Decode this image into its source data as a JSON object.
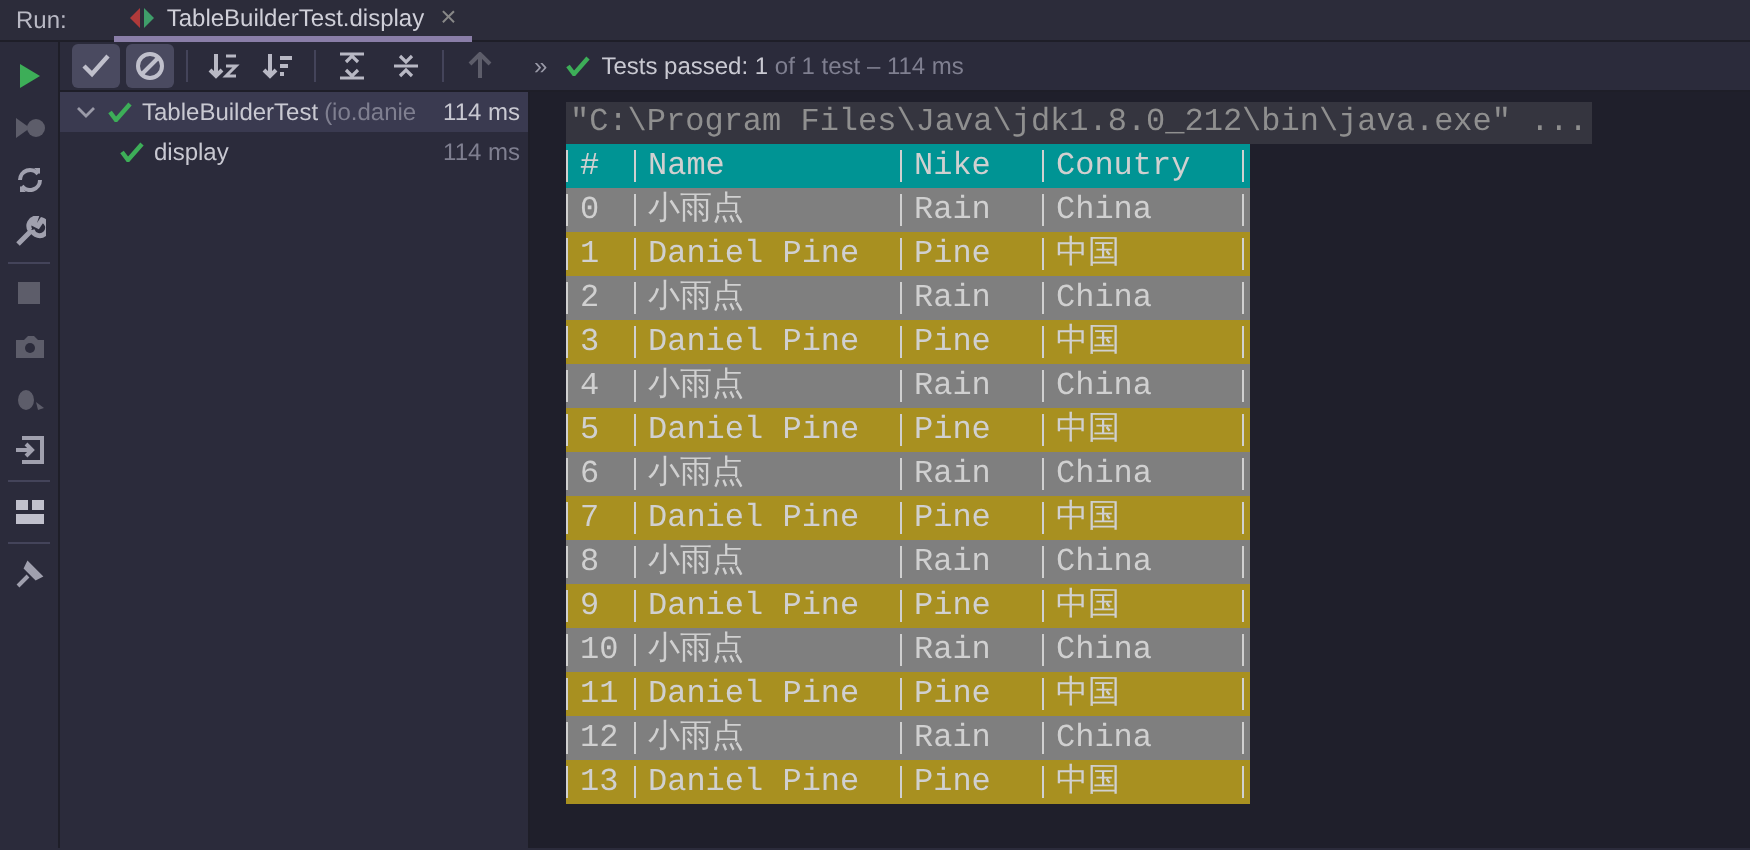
{
  "run_bar": {
    "label": "Run:",
    "tab": {
      "title": "TableBuilderTest.display",
      "close": "×",
      "selected": true
    }
  },
  "toolbar": {
    "toggles": [
      {
        "kind": "check",
        "selected": true
      },
      {
        "kind": "ignored",
        "selected": true
      }
    ],
    "overflow": "»",
    "status": {
      "passed": "Tests passed: 1",
      "rest": "of 1 test – 114 ms"
    }
  },
  "tree": [
    {
      "name": "TableBuilderTest",
      "package": "(io.danie",
      "time": "114 ms",
      "expanded": true,
      "selected": true,
      "children": [
        {
          "name": "display",
          "time": "114 ms",
          "selected": false
        }
      ]
    }
  ],
  "console": {
    "command": "\"C:\\Program Files\\Java\\jdk1.8.0_212\\bin\\java.exe\" ...",
    "rows": [
      {
        "color": "#009494",
        "cells": [
          "#",
          "Name",
          "Nike",
          "Conutry"
        ]
      },
      {
        "color": "#7f7f7f",
        "cells": [
          "0",
          "小雨点",
          "Rain",
          "China"
        ]
      },
      {
        "color": "#a89020",
        "cells": [
          "1",
          "Daniel Pine",
          "Pine",
          "中国"
        ]
      },
      {
        "color": "#7f7f7f",
        "cells": [
          "2",
          "小雨点",
          "Rain",
          "China"
        ]
      },
      {
        "color": "#a89020",
        "cells": [
          "3",
          "Daniel Pine",
          "Pine",
          "中国"
        ]
      },
      {
        "color": "#7f7f7f",
        "cells": [
          "4",
          "小雨点",
          "Rain",
          "China"
        ]
      },
      {
        "color": "#a89020",
        "cells": [
          "5",
          "Daniel Pine",
          "Pine",
          "中国"
        ]
      },
      {
        "color": "#7f7f7f",
        "cells": [
          "6",
          "小雨点",
          "Rain",
          "China"
        ]
      },
      {
        "color": "#a89020",
        "cells": [
          "7",
          "Daniel Pine",
          "Pine",
          "中国"
        ]
      },
      {
        "color": "#7f7f7f",
        "cells": [
          "8",
          "小雨点",
          "Rain",
          "China"
        ]
      },
      {
        "color": "#a89020",
        "cells": [
          "9",
          "Daniel Pine",
          "Pine",
          "中国"
        ]
      },
      {
        "color": "#7f7f7f",
        "cells": [
          "10",
          "小雨点",
          "Rain",
          "China"
        ]
      },
      {
        "color": "#a89020",
        "cells": [
          "11",
          "Daniel Pine",
          "Pine",
          "中国"
        ]
      },
      {
        "color": "#7f7f7f",
        "cells": [
          "12",
          "小雨点",
          "Rain",
          "China"
        ]
      },
      {
        "color": "#a89020",
        "cells": [
          "13",
          "Daniel Pine",
          "Pine",
          "中国"
        ]
      }
    ]
  }
}
